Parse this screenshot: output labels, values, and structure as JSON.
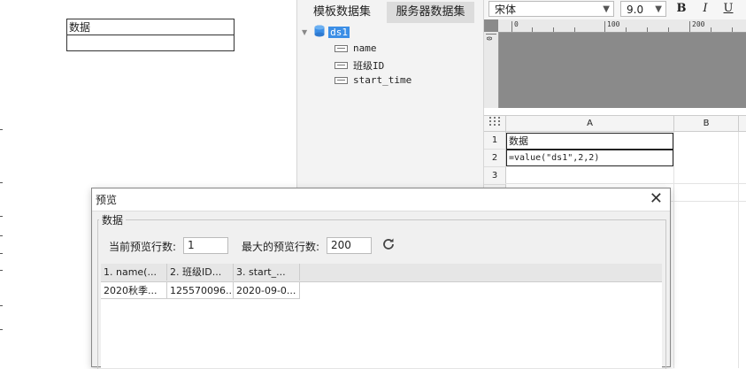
{
  "left_sheet": {
    "cell_header": "数据",
    "cell_empty": ""
  },
  "dataset_panel": {
    "tab_template": "模板数据集",
    "tab_server": "服务器数据集",
    "dataset_name": "ds1",
    "fields": [
      "name",
      "班级ID",
      "start_time"
    ]
  },
  "font_toolbar": {
    "font_family": "宋体",
    "font_size": "9.0",
    "bold": "B",
    "italic": "I",
    "underline": "U"
  },
  "ruler": {
    "h_labels": [
      "0",
      "100",
      "200"
    ],
    "v_label": "0"
  },
  "grid": {
    "corner_icon": "grid-corner-icon",
    "columns": [
      "A",
      "B"
    ],
    "rows": [
      "1",
      "2",
      "3"
    ],
    "a1": "数据",
    "a2": "=value(\"ds1\",2,2)"
  },
  "dialog": {
    "title": "预览",
    "group_label": "数据",
    "current_rows_label": "当前预览行数:",
    "current_rows_value": "1",
    "max_rows_label": "最大的预览行数:",
    "max_rows_value": "200",
    "columns": [
      "1. name(...",
      "2. 班级ID...",
      "3. start_..."
    ],
    "rows": [
      [
        "2020秋季...",
        "125570096...",
        "2020-09-0..."
      ]
    ]
  },
  "colors": {
    "dataset_highlight": "#3b8ee6",
    "canvas_gray": "#8a8a8a"
  }
}
